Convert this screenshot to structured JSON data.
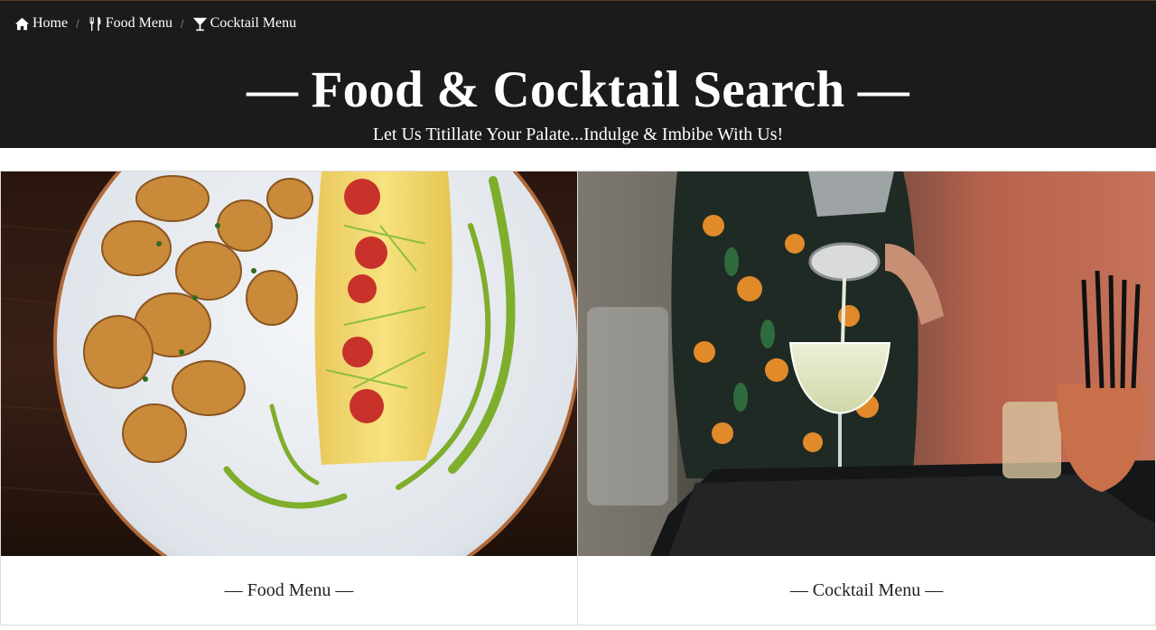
{
  "breadcrumb": {
    "home": {
      "label": "Home",
      "icon": "home-icon"
    },
    "food": {
      "label": "Food Menu",
      "icon": "utensils-icon"
    },
    "cocktail": {
      "label": "Cocktail Menu",
      "icon": "cocktail-glass-icon"
    },
    "separator": "/"
  },
  "header": {
    "title": "— Food & Cocktail Search —",
    "subtitle": "Let Us Titillate Your Palate...Indulge & Imbibe With Us!"
  },
  "cards": {
    "food": {
      "label": "— Food Menu —",
      "image": "food-plate-photo"
    },
    "cocktail": {
      "label": "— Cocktail Menu —",
      "image": "cocktail-bartender-photo"
    }
  },
  "colors": {
    "header_bg": "#1b1b1b",
    "text_light": "#ffffff",
    "card_border": "#dcdcdc"
  }
}
